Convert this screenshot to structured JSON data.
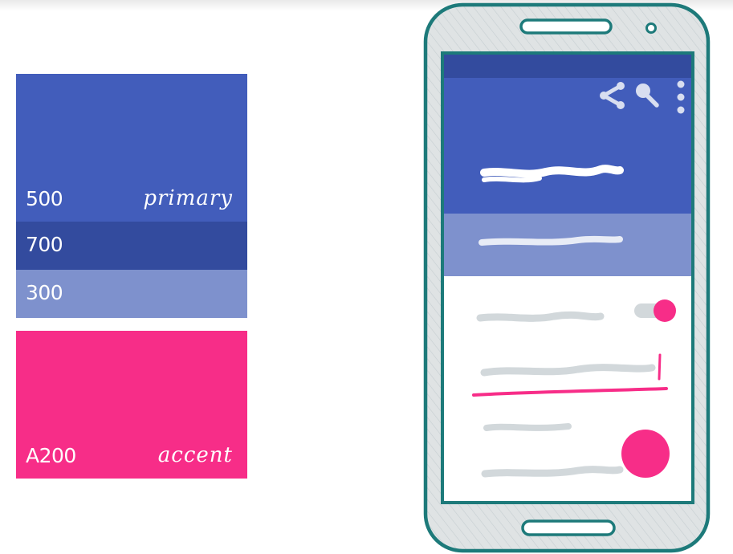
{
  "palette": {
    "primary_500": {
      "shade": "500",
      "role": "primary",
      "color": "#425dbb"
    },
    "primary_700": {
      "shade": "700",
      "color": "#334b9e"
    },
    "primary_300": {
      "shade": "300",
      "color": "#7e91cd"
    },
    "accent_a200": {
      "shade": "A200",
      "role": "accent",
      "color": "#f72d88"
    }
  },
  "phone": {
    "body_color": "#dfe3e4",
    "outline_color": "#1d7a7a",
    "status_bar_color": "#334b9e",
    "toolbar_color": "#425dbb",
    "tabs_color": "#7e91cd",
    "content_color": "#ffffff",
    "placeholder_color": "#d2d8db",
    "accent_color": "#f72d88",
    "toolbar_icons": [
      "share-icon",
      "search-icon",
      "overflow-menu-icon"
    ]
  }
}
